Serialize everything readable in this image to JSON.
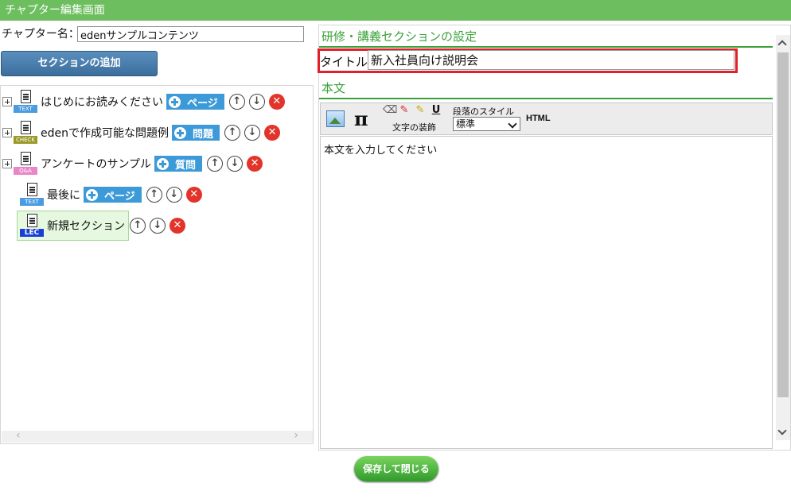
{
  "window": {
    "title": "チャプター編集画面"
  },
  "chapter": {
    "name_label": "チャプター名：",
    "name_value": "edenサンプルコンテンツ"
  },
  "left": {
    "add_section_label": "セクションの追加"
  },
  "tree": {
    "items": [
      {
        "icon_tag": "TEXT",
        "label": "はじめにお読みください",
        "add_label": "ページ"
      },
      {
        "icon_tag": "CHECK",
        "label": "edenで作成可能な問題例",
        "add_label": "問題"
      },
      {
        "icon_tag": "Q&A",
        "label": "アンケートのサンプル",
        "add_label": "質問"
      },
      {
        "icon_tag": "TEXT",
        "label": "最後に",
        "add_label": "ページ"
      },
      {
        "icon_tag": "LEC",
        "label": "新規セクション"
      }
    ],
    "up_glyph": "↑",
    "down_glyph": "↓",
    "delete_glyph": "✕"
  },
  "right": {
    "section_heading": "研修・講義セクションの設定",
    "title_label": "タイトル:",
    "title_value": "新入社員向け説明会",
    "body_heading": "本文",
    "toolbar": {
      "pi_symbol": "π",
      "decoration_label": "文字の装飾",
      "underline_symbol": "U",
      "paragraph_style_label": "段落のスタイル",
      "paragraph_style_value": "標準",
      "html_label": "HTML"
    },
    "body_placeholder": "本文を入力してください"
  },
  "footer": {
    "save_close_label": "保存して閉じる"
  },
  "colors": {
    "titlebar": "#6cbe5e",
    "heading_green": "#3aa13a",
    "highlight_red": "#e0202a",
    "add_button_blue": "#3d9ad8"
  }
}
